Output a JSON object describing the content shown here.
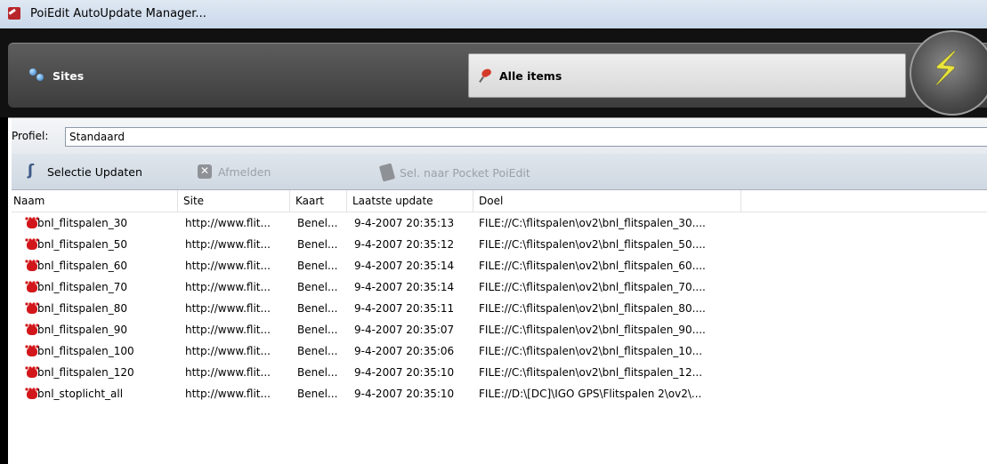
{
  "window": {
    "title": "PoiEdit AutoUpdate Manager..."
  },
  "tabs": {
    "sites": "Sites",
    "alle_items": "Alle items"
  },
  "orb": {
    "glyph": "⚡"
  },
  "profile": {
    "label": "Profiel:",
    "value": "Standaard"
  },
  "toolbar": {
    "update": "Selectie Updaten",
    "afmelden": "Afmelden",
    "pocket": "Sel. naar Pocket PoiEdit"
  },
  "columns": [
    "Naam",
    "Site",
    "Kaart",
    "Laatste update",
    "Doel"
  ],
  "rows": [
    {
      "naam": "bnl_flitspalen_30",
      "site": "http://www.flit...",
      "kaart": "Benel...",
      "update": "9-4-2007 20:35:13",
      "doel": "FILE://C:\\flitspalen\\ov2\\bnl_flitspalen_30...."
    },
    {
      "naam": "bnl_flitspalen_50",
      "site": "http://www.flit...",
      "kaart": "Benel...",
      "update": "9-4-2007 20:35:12",
      "doel": "FILE://C:\\flitspalen\\ov2\\bnl_flitspalen_50...."
    },
    {
      "naam": "bnl_flitspalen_60",
      "site": "http://www.flit...",
      "kaart": "Benel...",
      "update": "9-4-2007 20:35:14",
      "doel": "FILE://C:\\flitspalen\\ov2\\bnl_flitspalen_60...."
    },
    {
      "naam": "bnl_flitspalen_70",
      "site": "http://www.flit...",
      "kaart": "Benel...",
      "update": "9-4-2007 20:35:14",
      "doel": "FILE://C:\\flitspalen\\ov2\\bnl_flitspalen_70...."
    },
    {
      "naam": "bnl_flitspalen_80",
      "site": "http://www.flit...",
      "kaart": "Benel...",
      "update": "9-4-2007 20:35:11",
      "doel": "FILE://C:\\flitspalen\\ov2\\bnl_flitspalen_80...."
    },
    {
      "naam": "bnl_flitspalen_90",
      "site": "http://www.flit...",
      "kaart": "Benel...",
      "update": "9-4-2007 20:35:07",
      "doel": "FILE://C:\\flitspalen\\ov2\\bnl_flitspalen_90...."
    },
    {
      "naam": "bnl_flitspalen_100",
      "site": "http://www.flit...",
      "kaart": "Benel...",
      "update": "9-4-2007 20:35:06",
      "doel": "FILE://C:\\flitspalen\\ov2\\bnl_flitspalen_10..."
    },
    {
      "naam": "bnl_flitspalen_120",
      "site": "http://www.flit...",
      "kaart": "Benel...",
      "update": "9-4-2007 20:35:10",
      "doel": "FILE://C:\\flitspalen\\ov2\\bnl_flitspalen_12..."
    },
    {
      "naam": "bnl_stoplicht_all",
      "site": "http://www.flit...",
      "kaart": "Benel...",
      "update": "9-4-2007 20:35:10",
      "doel": "FILE://D:\\[DC]\\IGO GPS\\Flitspalen 2\\ov2\\..."
    }
  ]
}
